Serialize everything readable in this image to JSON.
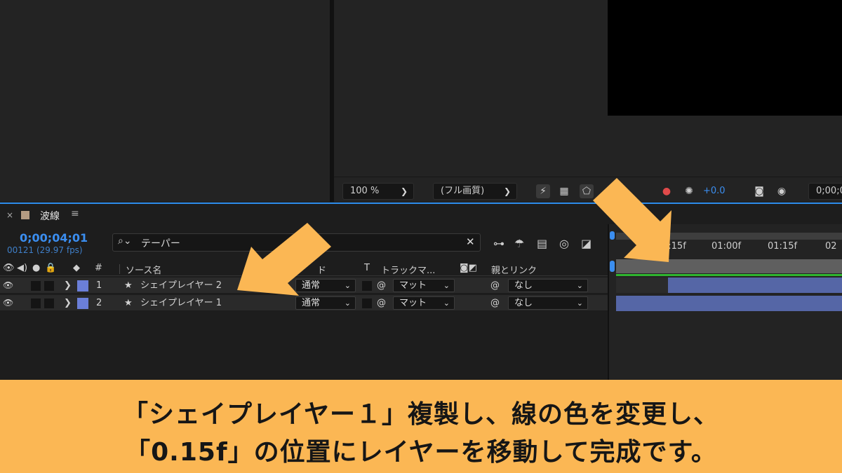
{
  "viewer": {
    "zoom": "100 %",
    "resolution": "(フル画質)",
    "exposure": "+0.0",
    "timecode_partial": "0;00;0"
  },
  "timeline": {
    "tab_close": "×",
    "comp_name": "波線",
    "menu_icon": "≡",
    "timecode": "0;00;04;01",
    "frames": "00121 (29.97 fps)",
    "search_value": "テーパー",
    "columns": {
      "num": "#",
      "source_name": "ソース名",
      "mode": "ド",
      "t": "T",
      "track_matte": "トラックマ...",
      "parent": "親とリンク"
    },
    "layers": [
      {
        "num": "1",
        "name": "シェイプレイヤー 2",
        "mode": "通常",
        "matte": "マット",
        "parent": "なし"
      },
      {
        "num": "2",
        "name": "シェイプレイヤー 1",
        "mode": "通常",
        "matte": "マット",
        "parent": "なし"
      }
    ],
    "ruler": [
      "0:15f",
      "01:00f",
      "01:15f",
      "02"
    ]
  },
  "caption": {
    "line1": "「シェイプレイヤー１」複製し、線の色を変更し、",
    "line2": "「0.15f」の位置にレイヤーを移動して完成です。"
  },
  "colors": {
    "accent_blue": "#3b8ef0",
    "layer_label": "#6b7fd8",
    "layer_bar": "#5566a6",
    "caption_bg": "#fbb754",
    "arrow": "#fbb754"
  }
}
